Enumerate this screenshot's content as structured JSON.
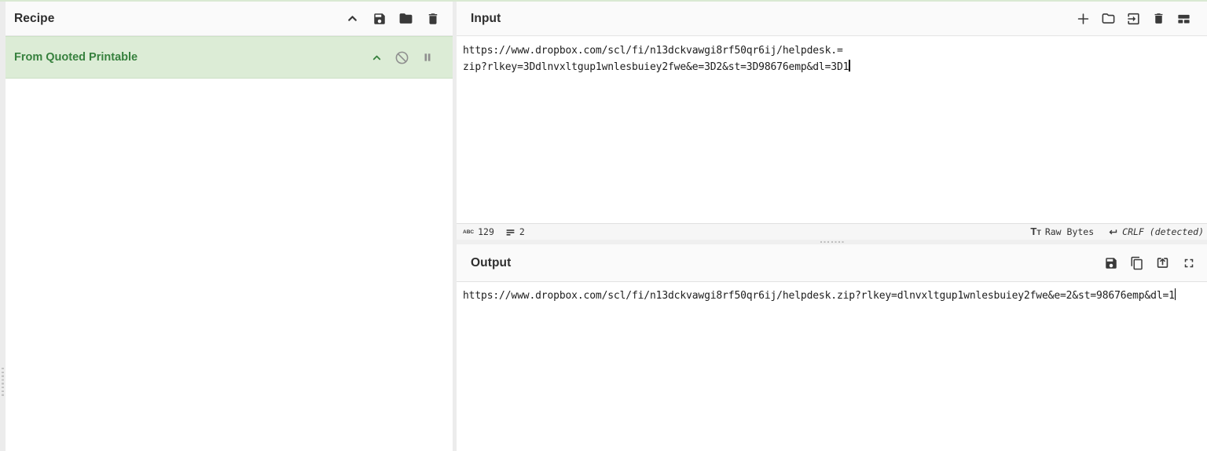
{
  "colors": {
    "accent_green_bg": "#dcecd6",
    "accent_green_text": "#37813e",
    "header_bg": "#fafafa",
    "icon": "#3a3a3a",
    "top_strip": "#d9e9d2"
  },
  "recipe": {
    "title": "Recipe",
    "toolbar_icons": [
      "collapse-chevron-up",
      "save-recipe",
      "load-recipe",
      "clear-recipe"
    ],
    "operations": [
      {
        "name": "From Quoted Printable",
        "icons": [
          "collapse-chevron-up",
          "disable-operation",
          "breakpoint-pause"
        ]
      }
    ]
  },
  "input": {
    "title": "Input",
    "toolbar_icons": [
      "add-input-tab",
      "open-file-as-input",
      "open-folder-as-input",
      "clear-input",
      "input-tabs-layout"
    ],
    "lines": [
      "https://www.dropbox.com/scl/fi/n13dckvawgi8rf50qr6ij/helpdesk.=",
      "zip?rlkey=3Ddlnvxltgup1wnlesbuiey2fwe&e=3D2&st=3D98676emp&dl=3D1"
    ],
    "status": {
      "char_count": "129",
      "line_count": "2",
      "character_encoding": "Raw Bytes",
      "eol": "CRLF (detected)"
    }
  },
  "output": {
    "title": "Output",
    "toolbar_icons": [
      "save-output",
      "copy-output",
      "replace-input-with-output",
      "maximize-output"
    ],
    "text": "https://www.dropbox.com/scl/fi/n13dckvawgi8rf50qr6ij/helpdesk.zip?rlkey=dlnvxltgup1wnlesbuiey2fwe&e=2&st=98676emp&dl=1"
  }
}
